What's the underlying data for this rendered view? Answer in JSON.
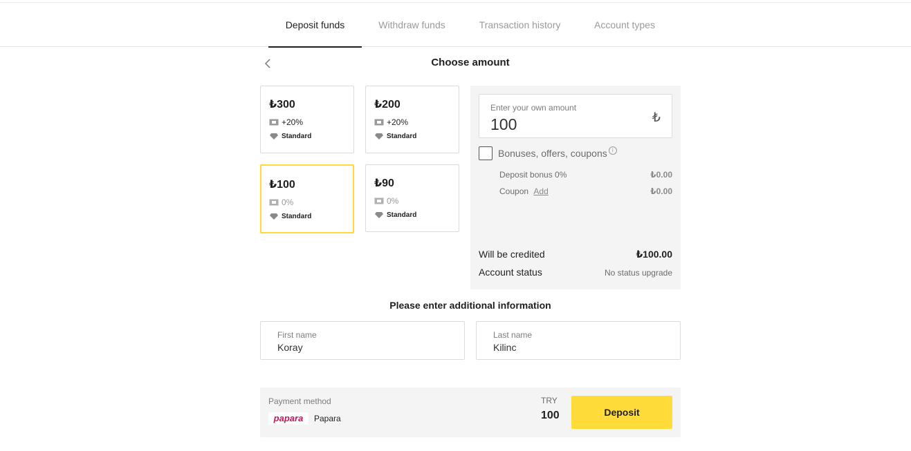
{
  "tabs": [
    {
      "label": "Deposit funds",
      "active": true
    },
    {
      "label": "Withdraw funds",
      "active": false
    },
    {
      "label": "Transaction history",
      "active": false
    },
    {
      "label": "Account types",
      "active": false
    }
  ],
  "amount_section": {
    "title": "Choose amount",
    "presets": [
      {
        "amount": "₺300",
        "bonus": "+20%",
        "account": "Standard",
        "selected": false
      },
      {
        "amount": "₺200",
        "bonus": "+20%",
        "account": "Standard",
        "selected": false
      },
      {
        "amount": "₺100",
        "bonus": "0%",
        "account": "Standard",
        "selected": true
      },
      {
        "amount": "₺90",
        "bonus": "0%",
        "account": "Standard",
        "selected": false
      }
    ]
  },
  "summary": {
    "own_amount_label": "Enter your own amount",
    "own_amount_value": "100",
    "currency_symbol": "₺",
    "bonuses_label": "Bonuses, offers, coupons",
    "deposit_bonus_label": "Deposit bonus 0%",
    "deposit_bonus_value": "₺0.00",
    "coupon_label": "Coupon",
    "coupon_link": "Add",
    "coupon_value": "₺0.00",
    "credited_label": "Will be credited",
    "credited_value": "₺100.00",
    "status_label": "Account status",
    "status_value": "No status upgrade"
  },
  "additional_info": {
    "title": "Please enter additional information",
    "first_name_label": "First name",
    "first_name_value": "Koray",
    "last_name_label": "Last name",
    "last_name_value": "Kilinc"
  },
  "payment": {
    "method_label": "Payment method",
    "logo_text": "papara",
    "method_name": "Papara",
    "currency": "TRY",
    "amount": "100",
    "deposit_button": "Deposit"
  },
  "colors": {
    "accent": "#ffdc3a",
    "selected_border": "#ffd83a",
    "papara_brand": "#c2185b"
  }
}
